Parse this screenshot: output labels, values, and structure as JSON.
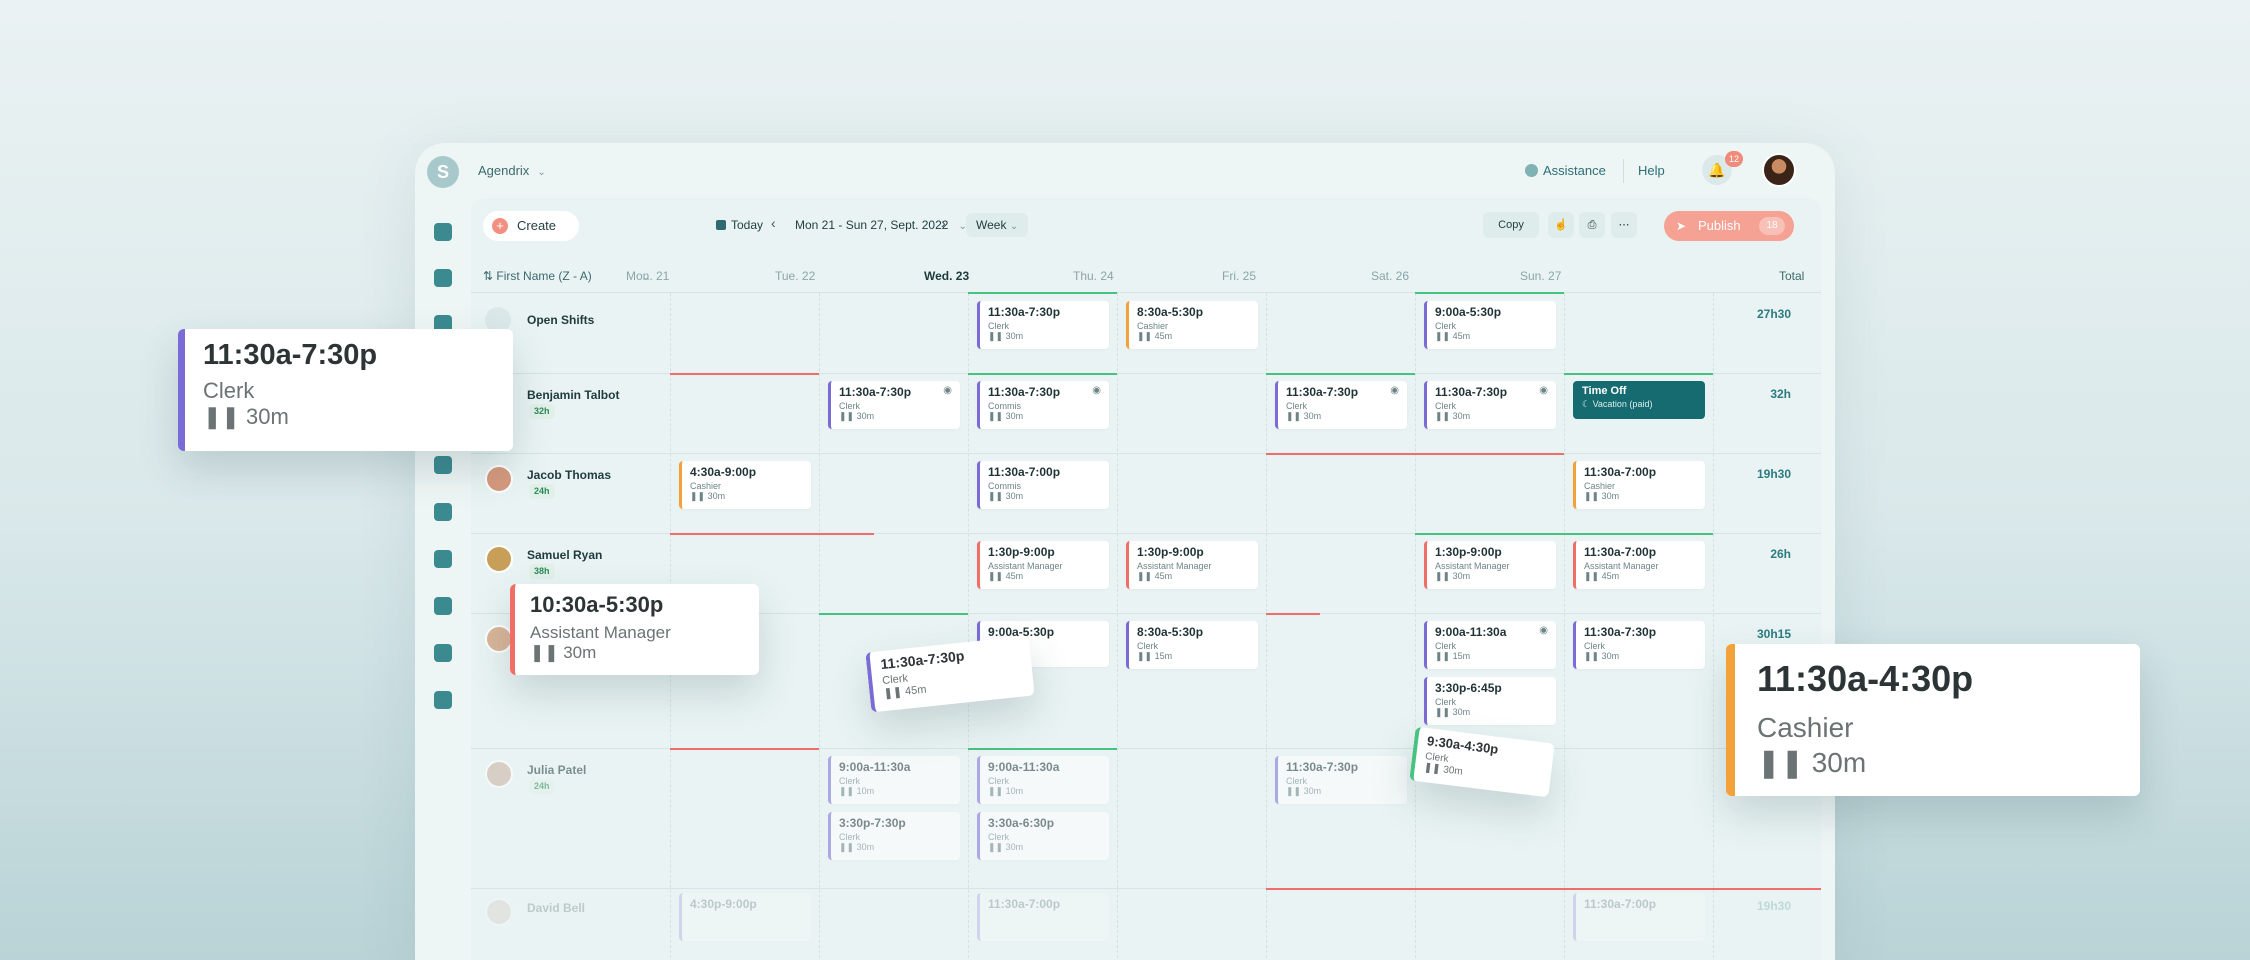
{
  "topbar": {
    "logo": "S",
    "org_name": "Agendrix",
    "assistance": "Assistance",
    "help": "Help",
    "notifications": "12"
  },
  "toolbar": {
    "create": "Create",
    "today": "Today",
    "date_range": "Mon 21 - Sun 27, Sept. 2022",
    "view": "Week",
    "copy": "Copy",
    "publish": "Publish",
    "publish_count": "18"
  },
  "grid": {
    "sort": "First Name (Z - A)",
    "days": [
      "Mon. 21",
      "Tue. 22",
      "Wed. 23",
      "Thu. 24",
      "Fri. 25",
      "Sat. 26",
      "Sun. 27"
    ],
    "total_label": "Total"
  },
  "rows": [
    {
      "name": "Open Shifts",
      "hours": "",
      "total": "27h30"
    },
    {
      "name": "Benjamin Talbot",
      "hours": "32h",
      "total": "32h"
    },
    {
      "name": "Jacob Thomas",
      "hours": "24h",
      "total": "19h30"
    },
    {
      "name": "Samuel Ryan",
      "hours": "38h",
      "total": "26h"
    },
    {
      "name": "",
      "hours": "",
      "total": "30h15"
    },
    {
      "name": "Julia Patel",
      "hours": "24h",
      "total": ""
    },
    {
      "name": "David Bell",
      "hours": "",
      "total": "19h30"
    }
  ],
  "shifts": {
    "open_wed": {
      "time": "11:30a-7:30p",
      "role": "Clerk",
      "brk": "30m"
    },
    "open_thu": {
      "time": "8:30a-5:30p",
      "role": "Cashier",
      "brk": "45m"
    },
    "open_sat": {
      "time": "9:00a-5:30p",
      "role": "Clerk",
      "brk": "45m"
    },
    "ben_tue": {
      "time": "11:30a-7:30p",
      "role": "Clerk",
      "brk": "30m"
    },
    "ben_wed": {
      "time": "11:30a-7:30p",
      "role": "Commis",
      "brk": "30m"
    },
    "ben_fri": {
      "time": "11:30a-7:30p",
      "role": "Clerk",
      "brk": "30m"
    },
    "ben_sat": {
      "time": "11:30a-7:30p",
      "role": "Clerk",
      "brk": "30m"
    },
    "ben_sun": {
      "time": "Time Off",
      "role": "Vacation (paid)"
    },
    "jac_mon": {
      "time": "4:30a-9:00p",
      "role": "Cashier",
      "brk": "30m"
    },
    "jac_wed": {
      "time": "11:30a-7:00p",
      "role": "Commis",
      "brk": "30m"
    },
    "jac_sun": {
      "time": "11:30a-7:00p",
      "role": "Cashier",
      "brk": "30m"
    },
    "sam_wed": {
      "time": "1:30p-9:00p",
      "role": "Assistant Manager",
      "brk": "45m"
    },
    "sam_thu": {
      "time": "1:30p-9:00p",
      "role": "Assistant Manager",
      "brk": "45m"
    },
    "sam_sat": {
      "time": "1:30p-9:00p",
      "role": "Assistant Manager",
      "brk": "30m"
    },
    "sam_sun": {
      "time": "11:30a-7:00p",
      "role": "Assistant Manager",
      "brk": "45m"
    },
    "r5_wed": {
      "time": "9:00a-5:30p"
    },
    "r5_thu": {
      "time": "8:30a-5:30p",
      "role": "Clerk",
      "brk": "15m"
    },
    "r5_sat1": {
      "time": "9:00a-11:30a",
      "role": "Clerk",
      "brk": "15m"
    },
    "r5_sat2": {
      "time": "3:30p-6:45p",
      "role": "Clerk",
      "brk": "30m"
    },
    "r5_sun": {
      "time": "11:30a-7:30p",
      "role": "Clerk",
      "brk": "30m"
    },
    "jul_tue1": {
      "time": "9:00a-11:30a",
      "role": "Clerk",
      "brk": "10m"
    },
    "jul_tue2": {
      "time": "3:30p-7:30p",
      "role": "Clerk",
      "brk": "30m"
    },
    "jul_wed1": {
      "time": "9:00a-11:30a",
      "role": "Clerk",
      "brk": "10m"
    },
    "jul_wed2": {
      "time": "3:30a-6:30p",
      "role": "Clerk",
      "brk": "30m"
    },
    "jul_fri": {
      "time": "11:30a-7:30p",
      "role": "Clerk",
      "brk": "30m"
    },
    "dav_mon": {
      "time": "4:30p-9:00p"
    },
    "dav_wed": {
      "time": "11:30a-7:00p"
    },
    "dav_sun": {
      "time": "11:30a-7:00p"
    }
  },
  "floating": {
    "card1": {
      "time": "11:30a-7:30p",
      "role": "Clerk",
      "brk": "30m"
    },
    "card2": {
      "time": "10:30a-5:30p",
      "role": "Assistant Manager",
      "brk": "30m"
    },
    "card3": {
      "time": "11:30a-7:30p",
      "role": "Clerk",
      "brk": "45m"
    },
    "card4": {
      "time": "9:30a-4:30p",
      "role": "Clerk",
      "brk": "30m"
    },
    "card5": {
      "time": "11:30a-4:30p",
      "role": "Cashier",
      "brk": "30m"
    }
  },
  "colors": {
    "accent": "#156b70",
    "clerk": "#7a6bd6",
    "cashier": "#f2a23a",
    "manager": "#ef6f68",
    "publish": "#f5a193"
  }
}
